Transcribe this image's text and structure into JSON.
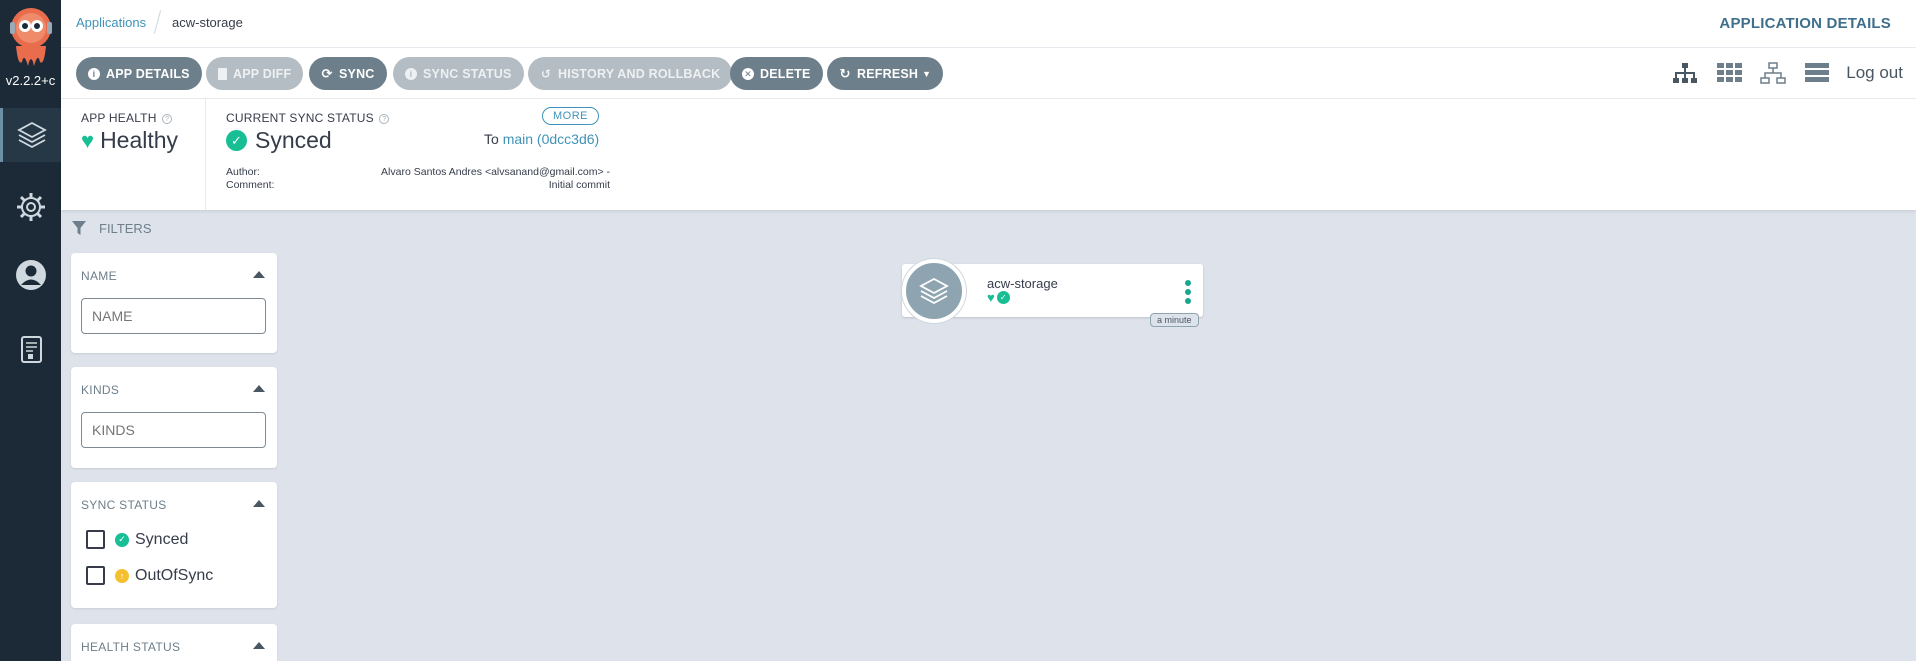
{
  "app": {
    "version": "v2.2.2+c"
  },
  "breadcrumb": {
    "root": "Applications",
    "current": "acw-storage"
  },
  "page_title": "APPLICATION DETAILS",
  "toolbar": {
    "buttons": [
      {
        "label": "APP DETAILS",
        "icon": "info-icon",
        "enabled": true
      },
      {
        "label": "APP DIFF",
        "icon": "file-icon",
        "enabled": false
      },
      {
        "label": "SYNC",
        "icon": "sync-icon",
        "enabled": true
      },
      {
        "label": "SYNC STATUS",
        "icon": "info-icon",
        "enabled": false
      },
      {
        "label": "HISTORY AND ROLLBACK",
        "icon": "history-icon",
        "enabled": false
      },
      {
        "label": "DELETE",
        "icon": "close-circle-icon",
        "enabled": true
      },
      {
        "label": "REFRESH",
        "icon": "refresh-icon",
        "enabled": true
      }
    ],
    "logout_label": "Log out"
  },
  "status": {
    "health_label": "APP HEALTH",
    "health_value": "Healthy",
    "sync_label": "CURRENT SYNC STATUS",
    "sync_value": "Synced",
    "more_label": "MORE",
    "to_label": "To",
    "revision": "main (0dcc3d6)",
    "author_label": "Author:",
    "author_value": "Alvaro Santos Andres <alvsanand@gmail.com> -",
    "comment_label": "Comment:",
    "comment_value": "Initial commit"
  },
  "filters": {
    "title": "FILTERS",
    "name": {
      "title": "NAME",
      "placeholder": "NAME"
    },
    "kinds": {
      "title": "KINDS",
      "placeholder": "KINDS"
    },
    "sync_status": {
      "title": "SYNC STATUS",
      "options": [
        "Synced",
        "OutOfSync"
      ]
    },
    "health_status": {
      "title": "HEALTH STATUS"
    }
  },
  "node": {
    "name": "acw-storage",
    "age": "a minute"
  },
  "colors": {
    "healthy": "#18be94",
    "out_of_sync": "#f4c030",
    "link": "#3f93b8"
  }
}
